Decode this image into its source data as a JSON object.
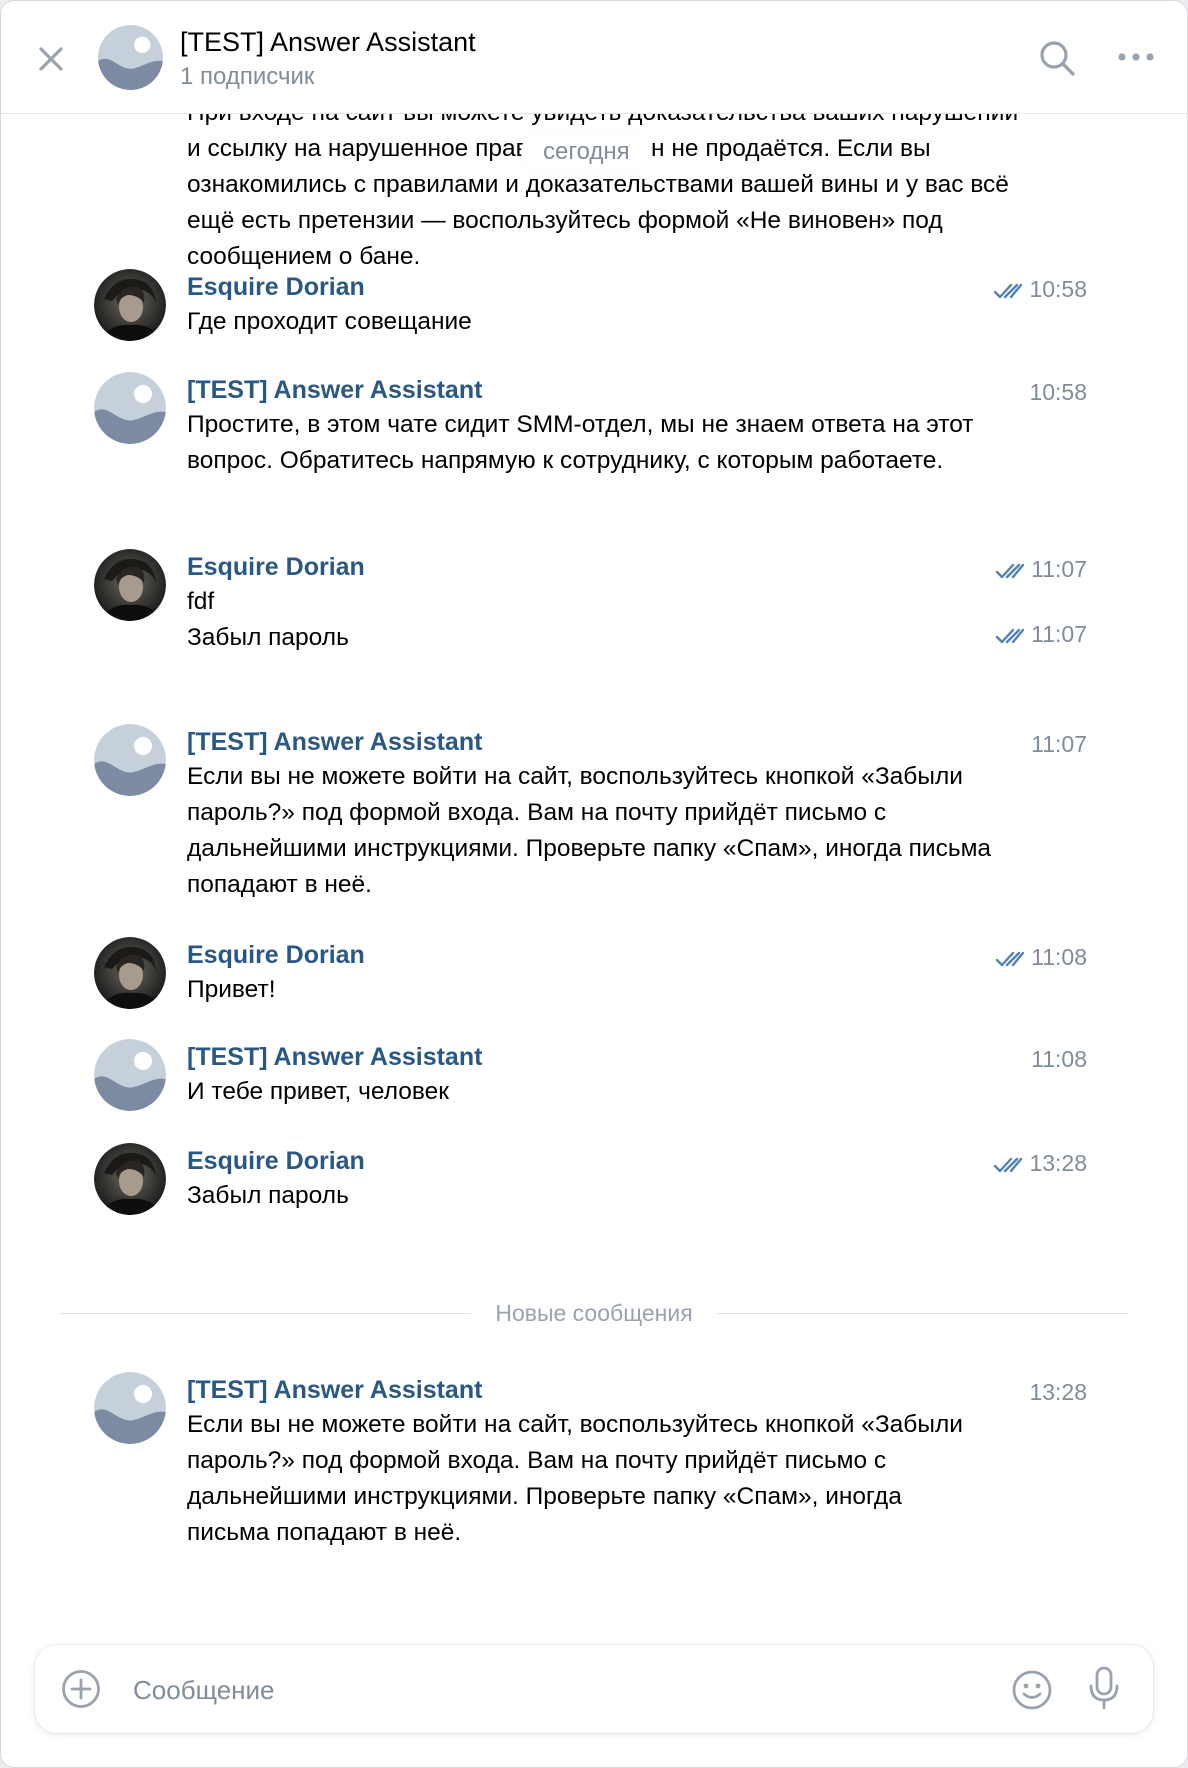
{
  "header": {
    "title": "[TEST] Answer Assistant",
    "subtitle": "1 подписчик",
    "icons": {
      "close": "close-icon",
      "search": "search-icon",
      "more": "more-icon"
    }
  },
  "chat": {
    "partial_message": "При входе на сайт вы можете увидеть доказательства ваших нарушений и ссылку на нарушенное правило. Разбан не продаётся. Если вы ознакомились с правилами и доказательствами вашей вины и у вас всё ещё есть претензии — воспользуйтесь формой «Не виновен» под сообщением о бане.",
    "date_label": "сегодня",
    "new_messages_label": "Новые сообщения",
    "messages": [
      {
        "author": "Esquire Dorian",
        "text": "Где проходит совещание",
        "time": "10:58",
        "read": true
      },
      {
        "author": "[TEST] Answer Assistant",
        "text": "Простите, в этом чате сидит SMM-отдел, мы не знаем ответа на этот вопрос. Обратитесь напрямую к сотруднику, с которым работаете.",
        "time": "10:58",
        "read": false
      },
      {
        "author": "Esquire Dorian",
        "text": "fdf",
        "time": "11:07",
        "read": true
      },
      {
        "author": "",
        "text": "Забыл пароль",
        "time": "11:07",
        "read": true
      },
      {
        "author": "[TEST] Answer Assistant",
        "text": "Если вы не можете войти на сайт, воспользуйтесь кнопкой «Забыли пароль?» под формой входа. Вам на почту прийдёт письмо с дальнейшими инструкциями. Проверьте папку «Спам», иногда письма попадают в неё.",
        "time": "11:07",
        "read": false
      },
      {
        "author": "Esquire Dorian",
        "text": "Привет!",
        "time": "11:08",
        "read": true
      },
      {
        "author": "[TEST] Answer Assistant",
        "text": "И тебе привет, человек",
        "time": "11:08",
        "read": false
      },
      {
        "author": "Esquire Dorian",
        "text": "Забыл пароль",
        "time": "13:28",
        "read": true
      },
      {
        "author": "[TEST] Answer Assistant",
        "text": "Если вы не можете войти на сайт, воспользуйтесь кнопкой «Забыли пароль?» под формой входа. Вам на почту прийдёт письмо с дальнейшими инструкциями. Проверьте папку «Спам», иногда письма попадают в неё.",
        "time": "13:28",
        "read": false
      }
    ]
  },
  "composer": {
    "placeholder": "Сообщение",
    "icons": {
      "attach": "add-attachment-icon",
      "emoji": "emoji-icon",
      "mic": "microphone-icon"
    }
  },
  "colors": {
    "accent": "#2a5885",
    "secondary_text": "#818c99",
    "read_ticks": "#5181b8",
    "bot_avatar_bg": "#c5d0db",
    "bot_avatar_fg": "#7c8ba2"
  }
}
